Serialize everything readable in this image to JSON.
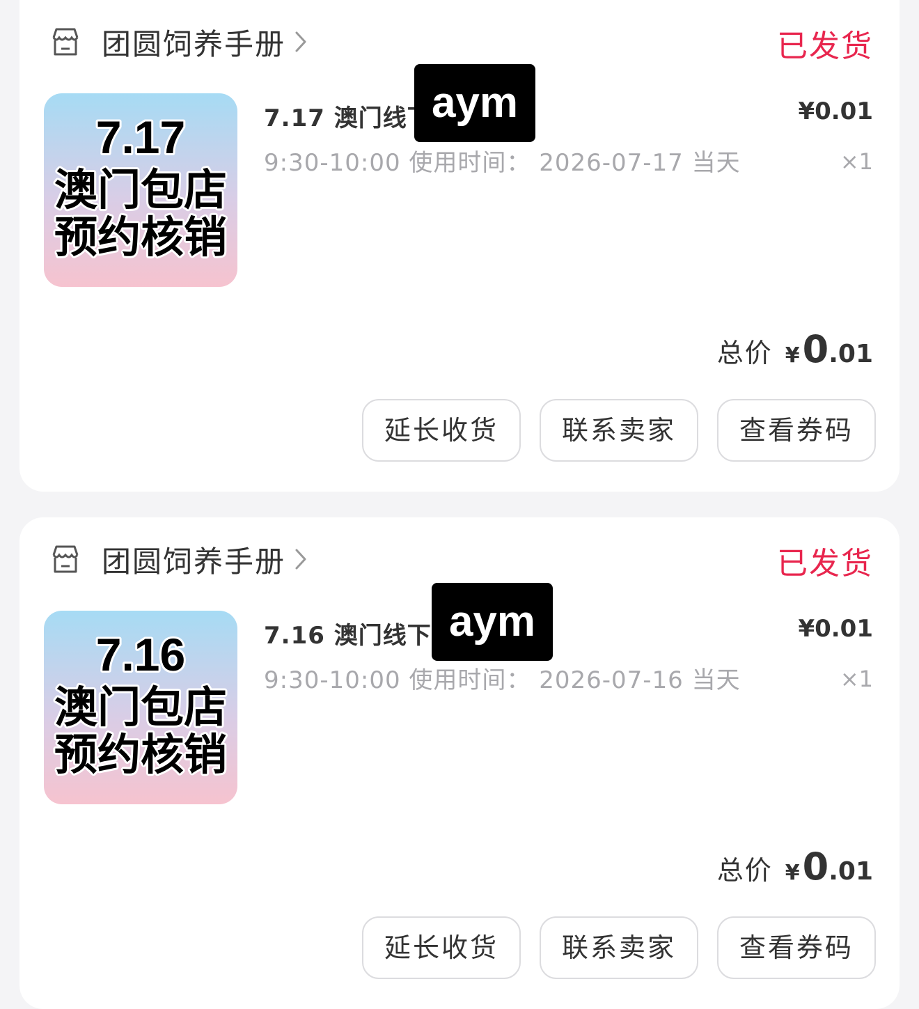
{
  "colors": {
    "status": "#e8264e",
    "muted": "#a8a8ac",
    "text": "#333333"
  },
  "orders": [
    {
      "shop_name": "团圆饲养手册",
      "status": "已发货",
      "thumb_lines": [
        "7.17",
        "澳门包店",
        "预约核销"
      ],
      "title": "7.17 澳门线下",
      "watermark": "aym",
      "usage": "9:30-10:00 使用时间： 2026-07-17 当天",
      "price": "¥0.01",
      "qty": "×1",
      "total_label": "总价",
      "total_symbol": "¥",
      "total_int": "0",
      "total_dec": ".01",
      "buttons": [
        "延长收货",
        "联系卖家",
        "查看券码"
      ]
    },
    {
      "shop_name": "团圆饲养手册",
      "status": "已发货",
      "thumb_lines": [
        "7.16",
        "澳门包店",
        "预约核销"
      ],
      "title": "7.16 澳门线下",
      "watermark": "aym",
      "usage": "9:30-10:00 使用时间： 2026-07-16 当天",
      "price": "¥0.01",
      "qty": "×1",
      "total_label": "总价",
      "total_symbol": "¥",
      "total_int": "0",
      "total_dec": ".01",
      "buttons": [
        "延长收货",
        "联系卖家",
        "查看券码"
      ]
    }
  ]
}
